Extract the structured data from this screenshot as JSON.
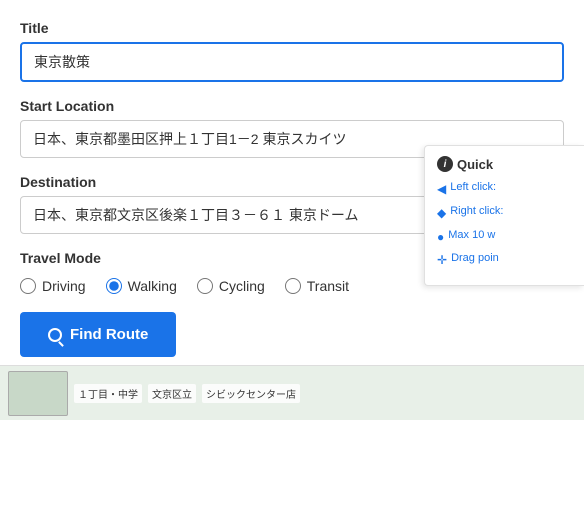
{
  "form": {
    "title_label": "Title",
    "title_value": "東京散策",
    "start_label": "Start Location",
    "start_value": "日本、東京都墨田区押上１丁目1－2 東京スカイツ",
    "destination_label": "Destination",
    "destination_value": "日本、東京都文京区後楽１丁目３－６１ 東京ドーム",
    "travel_mode_label": "Travel Mode",
    "travel_modes": [
      {
        "value": "driving",
        "label": "Driving",
        "checked": false
      },
      {
        "value": "walking",
        "label": "Walking",
        "checked": true
      },
      {
        "value": "cycling",
        "label": "Cycling",
        "checked": false
      },
      {
        "value": "transit",
        "label": "Transit",
        "checked": false
      }
    ],
    "find_route_btn": "Find Route"
  },
  "quick_help": {
    "title": "Quick",
    "items": [
      {
        "icon": "cursor",
        "text": "Left click:"
      },
      {
        "icon": "mouse",
        "text": "Right click:"
      },
      {
        "icon": "pin",
        "text": "Max 10 w"
      },
      {
        "icon": "move",
        "text": "Drag poin"
      }
    ]
  },
  "map": {
    "label1": "１丁目・中学",
    "label2": "文京区立",
    "label3": "シビックセンター店"
  }
}
